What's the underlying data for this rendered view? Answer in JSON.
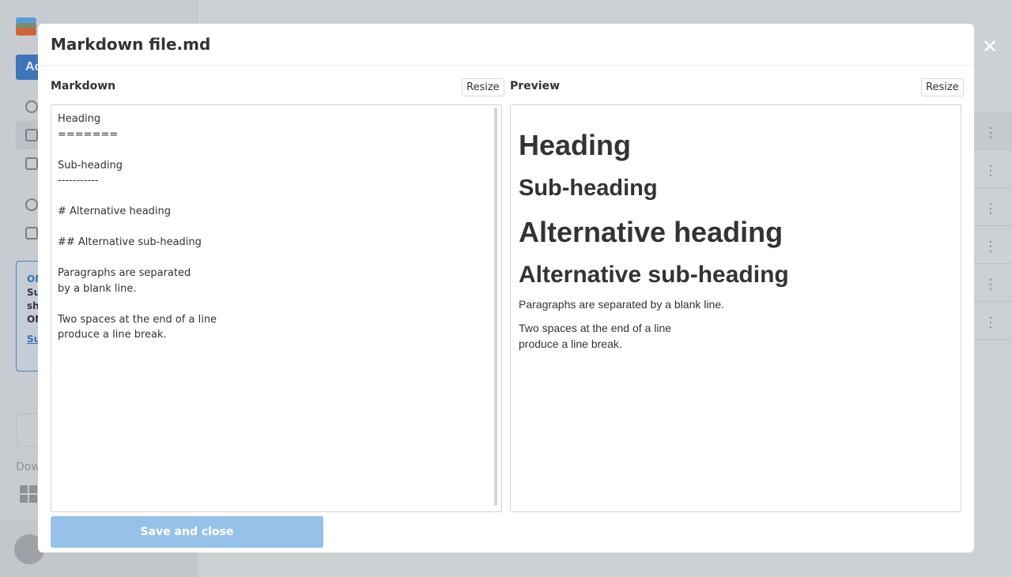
{
  "background": {
    "account_button": "Ac",
    "promo": {
      "title": "ON",
      "lines": [
        "Su",
        "sh",
        "ON"
      ],
      "link": "Su"
    },
    "download_label": "Dow"
  },
  "modal": {
    "title": "Markdown file.md",
    "close_icon": "close-icon",
    "markdown_label": "Markdown",
    "preview_label": "Preview",
    "resize_label": "Resize",
    "editor_value": "Heading\n=======\n\nSub-heading\n-----------\n\n# Alternative heading\n\n## Alternative sub-heading\n\nParagraphs are separated\nby a blank line.\n\nTwo spaces at the end of a line\nproduce a line break.",
    "preview": {
      "h1": "Heading",
      "h2": "Sub-heading",
      "h1_alt": "Alternative heading",
      "h2_alt": "Alternative sub-heading",
      "p1": "Paragraphs are separated by a blank line.",
      "p2_line1": "Two spaces at the end of a line",
      "p2_line2": "produce a line break."
    },
    "save_label": "Save and close",
    "save_color": "#98c1ea"
  }
}
